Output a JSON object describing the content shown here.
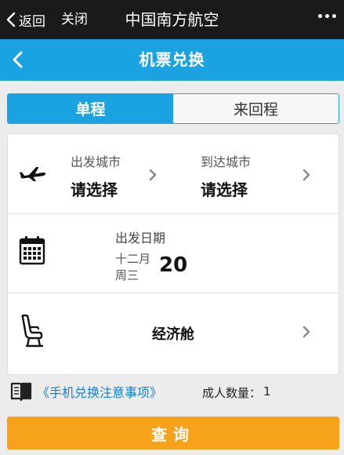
{
  "wechat": {
    "back_label": "返回",
    "close_label": "关闭",
    "title": "中国南方航空"
  },
  "app_bar": {
    "title": "机票兑换"
  },
  "trip_tabs": [
    {
      "label": "单程",
      "active": true
    },
    {
      "label": "来回程",
      "active": false
    }
  ],
  "route": {
    "departure_label": "出发城市",
    "departure_value": "请选择",
    "arrival_label": "到达城市",
    "arrival_value": "请选择"
  },
  "date": {
    "label": "出发日期",
    "month": "十二月",
    "weekday": "周三",
    "day": "20"
  },
  "cabin": {
    "value": "经济舱"
  },
  "notes_link": "《手机兑换注意事项》",
  "adults": {
    "label": "成人数量：",
    "count": "1"
  },
  "query_label": "查询",
  "colors": {
    "accent_blue": "#1aa3e0",
    "query_orange": "#f7a21b",
    "link_blue": "#1a7fc8",
    "wechat_bar": "#1a1a1a"
  },
  "icons": [
    "chevron-left-icon",
    "more-dots-icon",
    "airplane-icon",
    "chevron-right-icon",
    "calendar-icon",
    "seat-icon",
    "book-icon"
  ]
}
